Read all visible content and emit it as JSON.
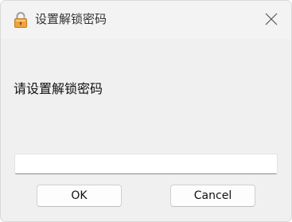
{
  "window": {
    "title": "设置解锁密码",
    "icon": "padlock-icon"
  },
  "prompt": "请设置解锁密码",
  "password_input": {
    "value": "",
    "placeholder": ""
  },
  "buttons": {
    "ok_label": "OK",
    "cancel_label": "Cancel"
  },
  "colors": {
    "lock_body": "#e8a33a",
    "lock_shackle": "#c98a2a"
  }
}
